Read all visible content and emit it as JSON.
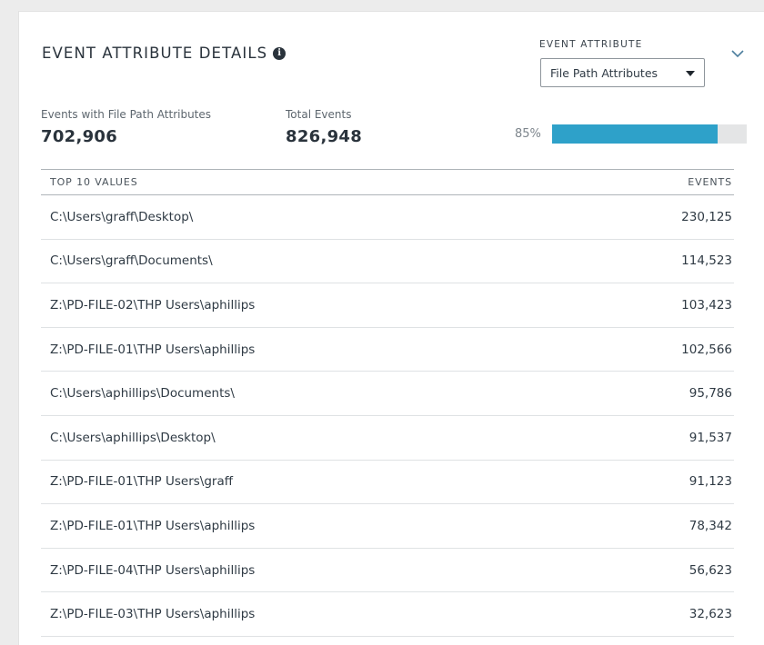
{
  "panel": {
    "title": "EVENT ATTRIBUTE DETAILS",
    "info_icon": "i"
  },
  "attribute_selector": {
    "label": "EVENT ATTRIBUTE",
    "selected": "File Path Attributes"
  },
  "stats": {
    "events_with_label": "Events with File Path Attributes",
    "events_with_value": "702,906",
    "total_label": "Total Events",
    "total_value": "826,948",
    "percent_label": "85%",
    "percent_value": 0.85
  },
  "table": {
    "col_value": "TOP 10 VALUES",
    "col_events": "EVENTS",
    "rows": [
      {
        "path": "C:\\Users\\graff\\Desktop\\",
        "events": "230,125"
      },
      {
        "path": "C:\\Users\\graff\\Documents\\",
        "events": "114,523"
      },
      {
        "path": "Z:\\PD-FILE-02\\THP Users\\aphillips",
        "events": "103,423"
      },
      {
        "path": "Z:\\PD-FILE-01\\THP Users\\aphillips",
        "events": "102,566"
      },
      {
        "path": "C:\\Users\\aphillips\\Documents\\",
        "events": "95,786"
      },
      {
        "path": "C:\\Users\\aphillips\\Desktop\\",
        "events": "91,537"
      },
      {
        "path": "Z:\\PD-FILE-01\\THP Users\\graff",
        "events": "91,123"
      },
      {
        "path": "Z:\\PD-FILE-01\\THP Users\\aphillips",
        "events": "78,342"
      },
      {
        "path": "Z:\\PD-FILE-04\\THP Users\\aphillips",
        "events": "56,623"
      },
      {
        "path": "Z:\\PD-FILE-03\\THP Users\\aphillips",
        "events": "32,623"
      }
    ]
  },
  "colors": {
    "accent": "#2ea1c9",
    "track": "#e4e5e6"
  },
  "icons": {
    "info": "info-icon",
    "collapse": "chevron-down-icon",
    "select_caret": "caret-down-icon"
  }
}
